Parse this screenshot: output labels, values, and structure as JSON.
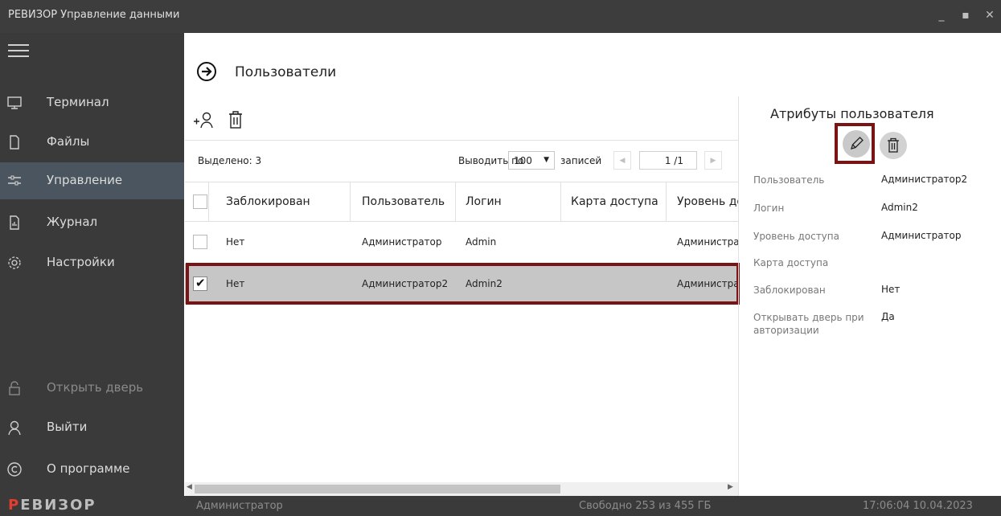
{
  "window": {
    "title": "РЕВИЗОР Управление данными"
  },
  "sidebar": {
    "items": [
      {
        "label": "Терминал",
        "icon": "terminal-icon"
      },
      {
        "label": "Файлы",
        "icon": "files-icon"
      },
      {
        "label": "Управление",
        "icon": "sliders-icon",
        "active": true
      },
      {
        "label": "Журнал",
        "icon": "journal-icon"
      },
      {
        "label": "Настройки",
        "icon": "gear-icon"
      }
    ],
    "bottom": [
      {
        "label": "Открыть дверь",
        "icon": "lock-icon"
      },
      {
        "label": "Выйти",
        "icon": "person-icon"
      },
      {
        "label": "О программе",
        "icon": "copyright-icon"
      }
    ]
  },
  "page": {
    "title": "Пользователи"
  },
  "list": {
    "selected": "Выделено: 3",
    "per_page_label": "Выводить по",
    "per_page_value": "100",
    "records_label": "записей",
    "page": "1 /1",
    "columns": [
      "Заблокирован",
      "Пользователь",
      "Логин",
      "Карта доступа",
      "Уровень до"
    ],
    "rows": [
      {
        "blocked": "Нет",
        "user": "Администратор",
        "login": "Admin",
        "card": "",
        "level": "Администра",
        "checked": false
      },
      {
        "blocked": "Нет",
        "user": "Администратор2",
        "login": "Admin2",
        "card": "",
        "level": "Администра",
        "checked": true
      }
    ]
  },
  "attributes": {
    "title": "Атрибуты пользователя",
    "fields": [
      {
        "label": "Пользователь",
        "value": "Администратор2"
      },
      {
        "label": "Логин",
        "value": "Admin2"
      },
      {
        "label": "Уровень доступа",
        "value": "Администратор"
      },
      {
        "label": "Карта доступа",
        "value": ""
      },
      {
        "label": "Заблокирован",
        "value": "Нет"
      },
      {
        "label": "Открывать дверь при авторизации",
        "value": "Да"
      }
    ]
  },
  "status": {
    "logo_first": "Р",
    "logo_rest": "ЕВИЗОР",
    "user": "Администратор",
    "free": "Свободно 253 из 455 ГБ",
    "clock": "17:06:04 10.04.2023"
  },
  "colors": {
    "sidebar": "#3a3a3a",
    "active": "#4a5560",
    "highlight": "#7a1414",
    "logo_accent": "#e43c2f"
  }
}
